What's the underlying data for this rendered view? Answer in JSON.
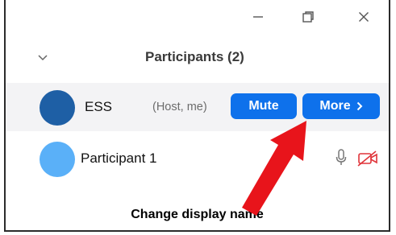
{
  "window": {
    "minimize_icon": "minimize-icon",
    "maximize_icon": "restore-icon",
    "close_icon": "close-icon"
  },
  "panel": {
    "title": "Participants (2)",
    "collapse_icon": "chevron-down-icon"
  },
  "participants": [
    {
      "name": "ESS",
      "role": "(Host, me)",
      "avatar_color": "#1e5fa5",
      "actions": {
        "mute_label": "Mute",
        "more_label": "More",
        "more_icon": "chevron-right-icon"
      }
    },
    {
      "name": "Participant 1",
      "avatar_color": "#5ab0f8",
      "mic_icon": "microphone-icon",
      "video_icon": "video-off-icon"
    }
  ],
  "annotation": {
    "caption": "Change display name",
    "arrow_color": "#e8141b"
  },
  "colors": {
    "button_blue": "#0e71eb",
    "host_row_bg": "#f3f3f5"
  }
}
